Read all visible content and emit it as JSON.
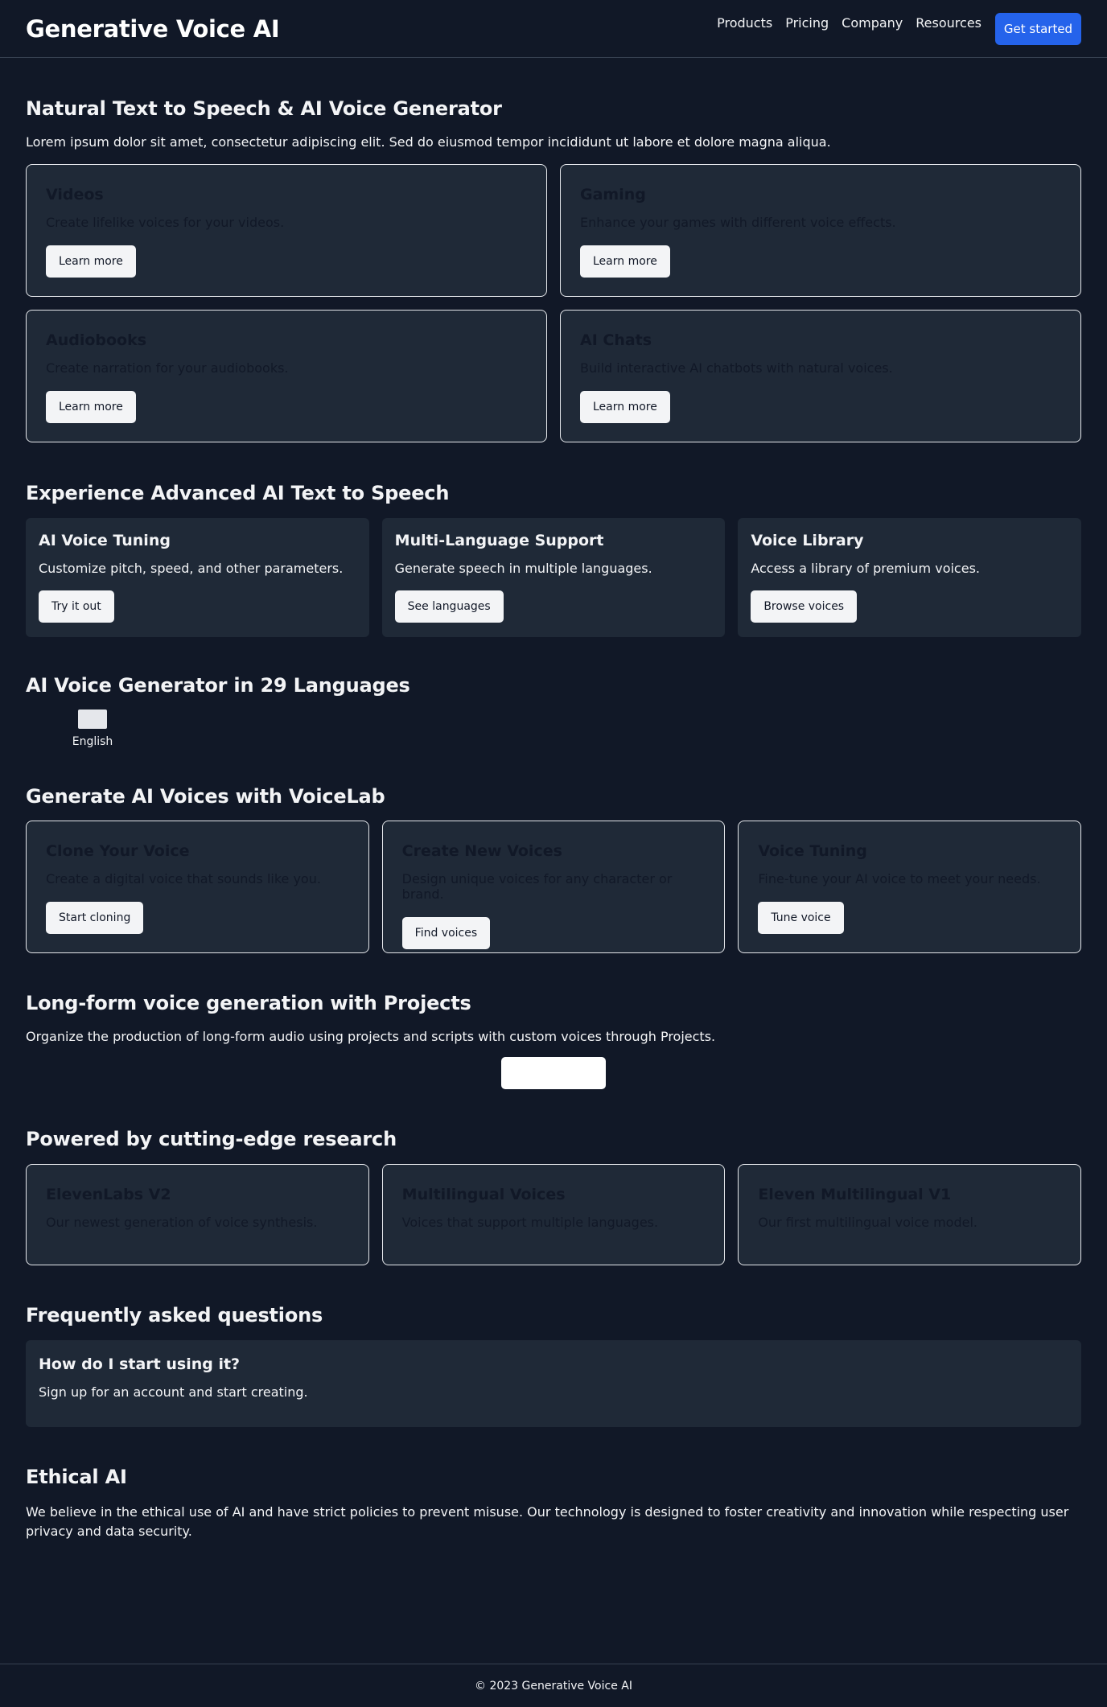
{
  "header": {
    "brand": "Generative Voice AI",
    "nav": [
      "Products",
      "Pricing",
      "Company",
      "Resources"
    ],
    "cta": "Get started"
  },
  "hero": {
    "title": "Natural Text to Speech & AI Voice Generator",
    "subtitle": "Lorem ipsum dolor sit amet, consectetur adipiscing elit. Sed do eiusmod tempor incididunt ut labore et dolore magna aliqua.",
    "cards": [
      {
        "title": "Videos",
        "desc": "Create lifelike voices for your videos.",
        "button": "Learn more"
      },
      {
        "title": "Gaming",
        "desc": "Enhance your games with different voice effects.",
        "button": "Learn more"
      },
      {
        "title": "Audiobooks",
        "desc": "Create narration for your audiobooks.",
        "button": "Learn more"
      },
      {
        "title": "AI Chats",
        "desc": "Build interactive AI chatbots with natural voices.",
        "button": "Learn more"
      }
    ]
  },
  "advanced": {
    "title": "Experience Advanced AI Text to Speech",
    "cards": [
      {
        "title": "AI Voice Tuning",
        "desc": "Customize pitch, speed, and other parameters.",
        "button": "Try it out"
      },
      {
        "title": "Multi-Language Support",
        "desc": "Generate speech in multiple languages.",
        "button": "See languages"
      },
      {
        "title": "Voice Library",
        "desc": "Access a library of premium voices.",
        "button": "Browse voices"
      }
    ]
  },
  "languages": {
    "title": "AI Voice Generator in 29 Languages",
    "items": [
      {
        "label": "English"
      }
    ]
  },
  "voicelab": {
    "title": "Generate AI Voices with VoiceLab",
    "cards": [
      {
        "title": "Clone Your Voice",
        "desc": "Create a digital voice that sounds like you.",
        "button": "Start cloning"
      },
      {
        "title": "Create New Voices",
        "desc": "Design unique voices for any character or brand.",
        "button": "Find voices"
      },
      {
        "title": "Voice Tuning",
        "desc": "Fine-tune your AI voice to meet your needs.",
        "button": "Tune voice"
      }
    ]
  },
  "projects": {
    "title": "Long-form voice generation with Projects",
    "desc": "Organize the production of long-form audio using projects and scripts with custom voices through Projects.",
    "button": ""
  },
  "research": {
    "title": "Powered by cutting-edge research",
    "cards": [
      {
        "title": "ElevenLabs V2",
        "desc": "Our newest generation of voice synthesis."
      },
      {
        "title": "Multilingual Voices",
        "desc": "Voices that support multiple languages."
      },
      {
        "title": "Eleven Multilingual V1",
        "desc": "Our first multilingual voice model."
      }
    ]
  },
  "faq": {
    "title": "Frequently asked questions",
    "items": [
      {
        "q": "How do I start using it?",
        "a": "Sign up for an account and start creating."
      }
    ]
  },
  "ethical": {
    "title": "Ethical AI",
    "text": "We believe in the ethical use of AI and have strict policies to prevent misuse. Our technology is designed to foster creativity and innovation while respecting user privacy and data security."
  },
  "footer": {
    "copyright": "© 2023 Generative Voice AI"
  },
  "colors": {
    "background": "#111827",
    "card": "#1f2937",
    "accent": "#2563eb",
    "button": "#f3f4f6"
  }
}
